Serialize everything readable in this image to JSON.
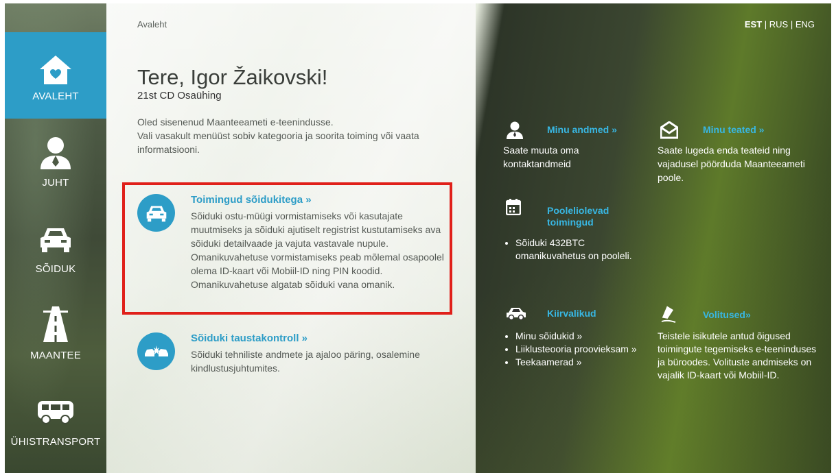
{
  "nav": [
    {
      "label": "AVALEHT",
      "icon": "home-icon",
      "active": true
    },
    {
      "label": "JUHT",
      "icon": "driver-icon",
      "active": false
    },
    {
      "label": "SÕIDUK",
      "icon": "car-icon",
      "active": false
    },
    {
      "label": "MAANTEE",
      "icon": "road-icon",
      "active": false
    },
    {
      "label": "ÜHISTRANSPORT",
      "icon": "bus-icon",
      "active": false
    }
  ],
  "breadcrumb": "Avaleht",
  "greeting": "Tere, Igor Žaikovski!",
  "company": "21st CD Osaühing",
  "intro": {
    "line1": "Oled sisenenud Maanteeameti e-teenindusse.",
    "line2": "Vali vasakult menüüst sobiv kategooria ja soorita toiming või vaata informatsiooni."
  },
  "cards": [
    {
      "title": "Toimingud sõidukitega »",
      "text": "Sõiduki ostu-müügi vormistamiseks või kasutajate muutmiseks ja sõiduki ajutiselt registrist kustutamiseks ava sõiduki detailvaade ja vajuta vastavale nupule. Omanikuvahetuse vormistamiseks peab mõlemal osapoolel olema ID-kaart või Mobiil-ID ning PIN koodid. Omanikuvahetuse algatab sõiduki vana omanik.",
      "icon": "car-icon"
    },
    {
      "title": "Sõiduki taustakontroll »",
      "text": "Sõiduki tehniliste andmete ja ajaloo päring, osalemine kindlustusjuhtumites.",
      "icon": "car-crash-icon"
    }
  ],
  "lang": {
    "est": "EST",
    "sep1": " | ",
    "rus": "RUS",
    "sep2": " | ",
    "eng": "ENG"
  },
  "right": {
    "my_data": {
      "title": "Minu andmed »",
      "text": "Saate muuta oma kontaktandmeid"
    },
    "my_messages": {
      "title": "Minu teated »",
      "text": "Saate lugeda enda teateid ning vajadusel pöörduda Maanteeameti poole."
    },
    "pending": {
      "title_line1": "Pooleliolevad",
      "title_line2": "toimingud",
      "items": [
        "Sõiduki 432BTC omanikuvahetus on pooleli."
      ]
    },
    "quick": {
      "title": "Kiirvalikud",
      "items": [
        "Minu sõidukid »",
        "Liiklusteooria proovieksam »",
        "Teekaamerad »"
      ]
    },
    "powers": {
      "title": "Volitused»",
      "text": "Teistele isikutele antud õigused toimingute tegemiseks e-teeninduses ja büroodes. Volituste andmiseks on vajalik ID-kaart või Mobiil-ID."
    }
  },
  "colors": {
    "accent": "#2d9dc7",
    "link_right": "#38b7e3",
    "highlight": "#e0201a"
  }
}
